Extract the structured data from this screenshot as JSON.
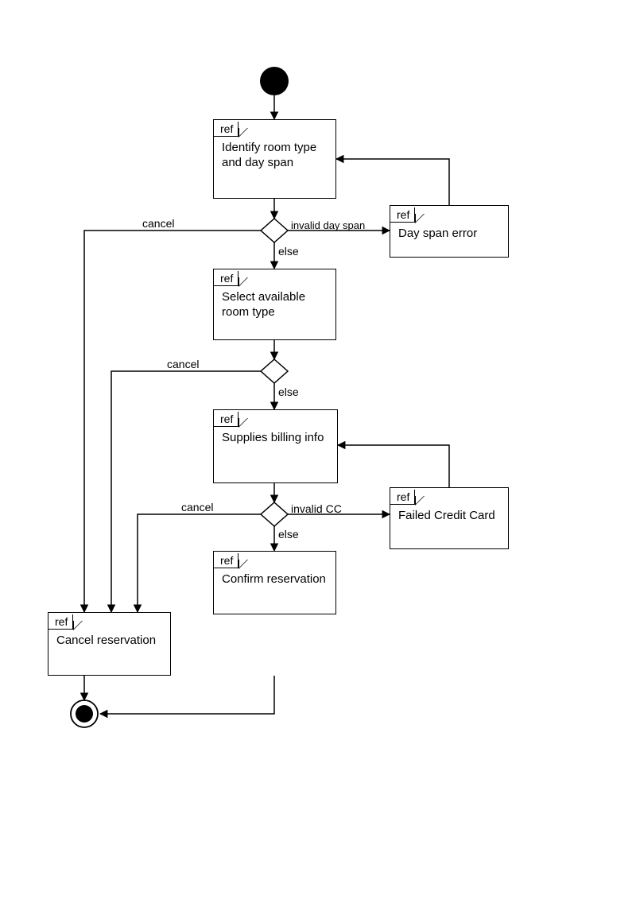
{
  "diagram": {
    "type": "uml-interaction-overview",
    "ref_tag": "ref",
    "nodes": {
      "identify": {
        "label": "Identify room type and day span"
      },
      "dayspanerr": {
        "label": "Day span error"
      },
      "select": {
        "label": "Select available room type"
      },
      "billing": {
        "label": "Supplies billing info"
      },
      "failedcc": {
        "label": "Failed Credit Card"
      },
      "cancel": {
        "label": "Cancel reservation"
      },
      "confirm": {
        "label": "Confirm reservation"
      }
    },
    "decision_labels": {
      "cancel1": "cancel",
      "invalid_day_span": "invalid day span",
      "else1": "else",
      "cancel2": "cancel",
      "else2": "else",
      "cancel3": "cancel",
      "invalid_cc": "invalid CC",
      "else3": "else"
    }
  }
}
